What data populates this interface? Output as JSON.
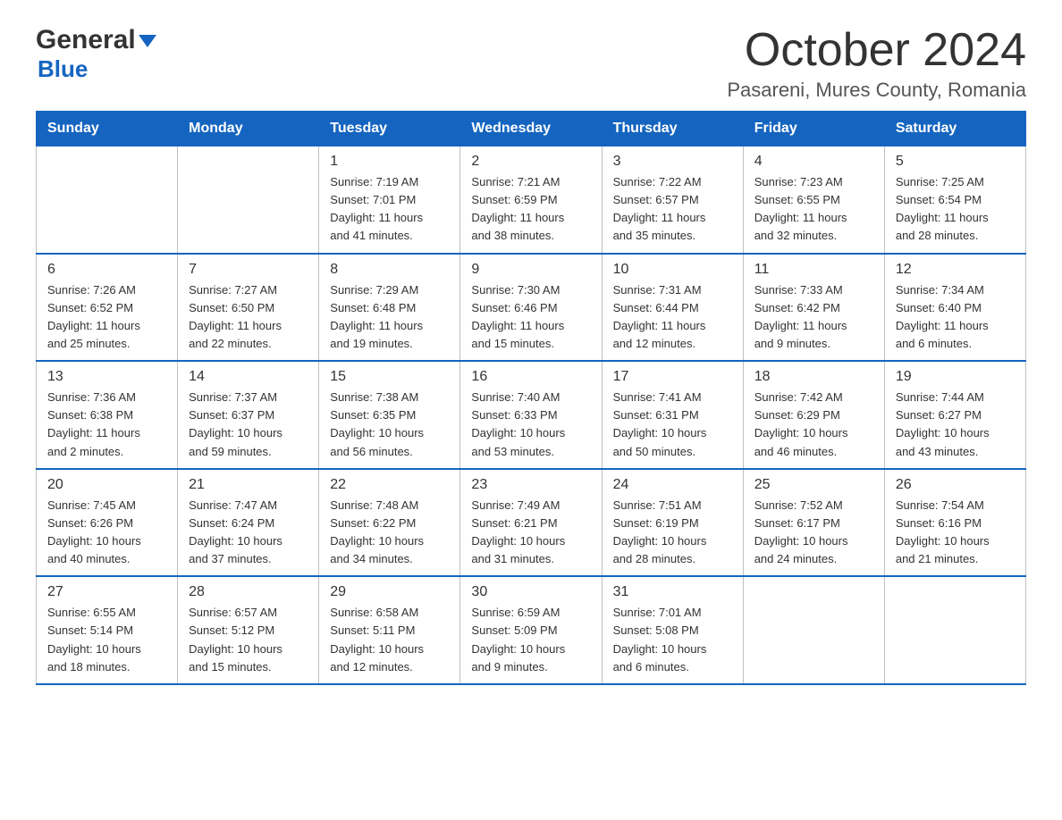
{
  "logo": {
    "text1": "General",
    "text2": "Blue"
  },
  "title": "October 2024",
  "subtitle": "Pasareni, Mures County, Romania",
  "headers": [
    "Sunday",
    "Monday",
    "Tuesday",
    "Wednesday",
    "Thursday",
    "Friday",
    "Saturday"
  ],
  "weeks": [
    [
      {
        "num": "",
        "info": ""
      },
      {
        "num": "",
        "info": ""
      },
      {
        "num": "1",
        "info": "Sunrise: 7:19 AM\nSunset: 7:01 PM\nDaylight: 11 hours\nand 41 minutes."
      },
      {
        "num": "2",
        "info": "Sunrise: 7:21 AM\nSunset: 6:59 PM\nDaylight: 11 hours\nand 38 minutes."
      },
      {
        "num": "3",
        "info": "Sunrise: 7:22 AM\nSunset: 6:57 PM\nDaylight: 11 hours\nand 35 minutes."
      },
      {
        "num": "4",
        "info": "Sunrise: 7:23 AM\nSunset: 6:55 PM\nDaylight: 11 hours\nand 32 minutes."
      },
      {
        "num": "5",
        "info": "Sunrise: 7:25 AM\nSunset: 6:54 PM\nDaylight: 11 hours\nand 28 minutes."
      }
    ],
    [
      {
        "num": "6",
        "info": "Sunrise: 7:26 AM\nSunset: 6:52 PM\nDaylight: 11 hours\nand 25 minutes."
      },
      {
        "num": "7",
        "info": "Sunrise: 7:27 AM\nSunset: 6:50 PM\nDaylight: 11 hours\nand 22 minutes."
      },
      {
        "num": "8",
        "info": "Sunrise: 7:29 AM\nSunset: 6:48 PM\nDaylight: 11 hours\nand 19 minutes."
      },
      {
        "num": "9",
        "info": "Sunrise: 7:30 AM\nSunset: 6:46 PM\nDaylight: 11 hours\nand 15 minutes."
      },
      {
        "num": "10",
        "info": "Sunrise: 7:31 AM\nSunset: 6:44 PM\nDaylight: 11 hours\nand 12 minutes."
      },
      {
        "num": "11",
        "info": "Sunrise: 7:33 AM\nSunset: 6:42 PM\nDaylight: 11 hours\nand 9 minutes."
      },
      {
        "num": "12",
        "info": "Sunrise: 7:34 AM\nSunset: 6:40 PM\nDaylight: 11 hours\nand 6 minutes."
      }
    ],
    [
      {
        "num": "13",
        "info": "Sunrise: 7:36 AM\nSunset: 6:38 PM\nDaylight: 11 hours\nand 2 minutes."
      },
      {
        "num": "14",
        "info": "Sunrise: 7:37 AM\nSunset: 6:37 PM\nDaylight: 10 hours\nand 59 minutes."
      },
      {
        "num": "15",
        "info": "Sunrise: 7:38 AM\nSunset: 6:35 PM\nDaylight: 10 hours\nand 56 minutes."
      },
      {
        "num": "16",
        "info": "Sunrise: 7:40 AM\nSunset: 6:33 PM\nDaylight: 10 hours\nand 53 minutes."
      },
      {
        "num": "17",
        "info": "Sunrise: 7:41 AM\nSunset: 6:31 PM\nDaylight: 10 hours\nand 50 minutes."
      },
      {
        "num": "18",
        "info": "Sunrise: 7:42 AM\nSunset: 6:29 PM\nDaylight: 10 hours\nand 46 minutes."
      },
      {
        "num": "19",
        "info": "Sunrise: 7:44 AM\nSunset: 6:27 PM\nDaylight: 10 hours\nand 43 minutes."
      }
    ],
    [
      {
        "num": "20",
        "info": "Sunrise: 7:45 AM\nSunset: 6:26 PM\nDaylight: 10 hours\nand 40 minutes."
      },
      {
        "num": "21",
        "info": "Sunrise: 7:47 AM\nSunset: 6:24 PM\nDaylight: 10 hours\nand 37 minutes."
      },
      {
        "num": "22",
        "info": "Sunrise: 7:48 AM\nSunset: 6:22 PM\nDaylight: 10 hours\nand 34 minutes."
      },
      {
        "num": "23",
        "info": "Sunrise: 7:49 AM\nSunset: 6:21 PM\nDaylight: 10 hours\nand 31 minutes."
      },
      {
        "num": "24",
        "info": "Sunrise: 7:51 AM\nSunset: 6:19 PM\nDaylight: 10 hours\nand 28 minutes."
      },
      {
        "num": "25",
        "info": "Sunrise: 7:52 AM\nSunset: 6:17 PM\nDaylight: 10 hours\nand 24 minutes."
      },
      {
        "num": "26",
        "info": "Sunrise: 7:54 AM\nSunset: 6:16 PM\nDaylight: 10 hours\nand 21 minutes."
      }
    ],
    [
      {
        "num": "27",
        "info": "Sunrise: 6:55 AM\nSunset: 5:14 PM\nDaylight: 10 hours\nand 18 minutes."
      },
      {
        "num": "28",
        "info": "Sunrise: 6:57 AM\nSunset: 5:12 PM\nDaylight: 10 hours\nand 15 minutes."
      },
      {
        "num": "29",
        "info": "Sunrise: 6:58 AM\nSunset: 5:11 PM\nDaylight: 10 hours\nand 12 minutes."
      },
      {
        "num": "30",
        "info": "Sunrise: 6:59 AM\nSunset: 5:09 PM\nDaylight: 10 hours\nand 9 minutes."
      },
      {
        "num": "31",
        "info": "Sunrise: 7:01 AM\nSunset: 5:08 PM\nDaylight: 10 hours\nand 6 minutes."
      },
      {
        "num": "",
        "info": ""
      },
      {
        "num": "",
        "info": ""
      }
    ]
  ]
}
